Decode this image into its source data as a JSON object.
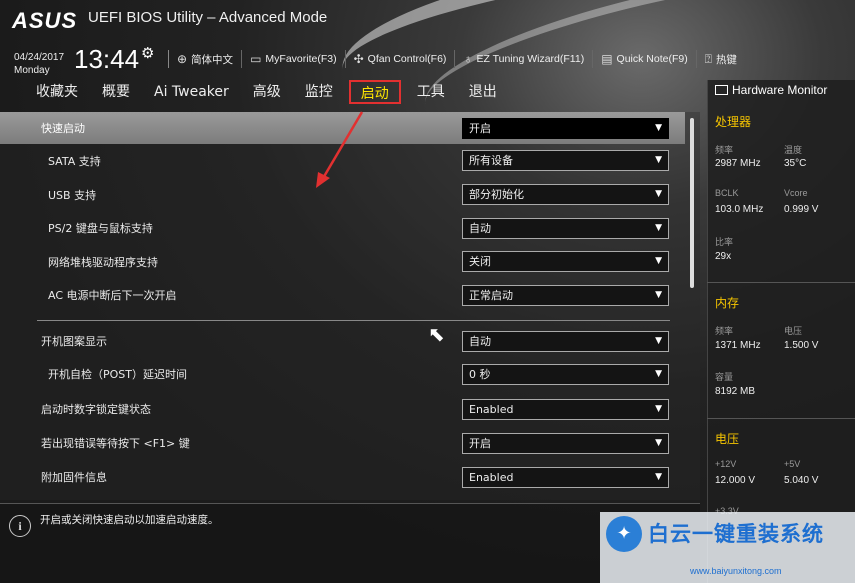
{
  "header": {
    "logo": "ASUS",
    "title": "UEFI BIOS Utility – Advanced Mode",
    "date": "04/24/2017",
    "weekday": "Monday",
    "time": "13:44",
    "toolbar": [
      {
        "icon": "globe-icon",
        "label": "简体中文"
      },
      {
        "icon": "favorite-icon",
        "label": "MyFavorite(F3)"
      },
      {
        "icon": "fan-icon",
        "label": "Qfan Control(F6)"
      },
      {
        "icon": "lightbulb-icon",
        "label": "EZ Tuning Wizard(F11)"
      },
      {
        "icon": "note-icon",
        "label": "Quick Note(F9)"
      },
      {
        "icon": "help-icon",
        "label": "热键"
      }
    ]
  },
  "nav": {
    "tabs": [
      "收藏夹",
      "概要",
      "Ai Tweaker",
      "高级",
      "监控",
      "启动",
      "工具",
      "退出"
    ],
    "active": "启动"
  },
  "settings": [
    {
      "label": "快速启动",
      "value": "开启"
    },
    {
      "label": "SATA 支持",
      "value": "所有设备"
    },
    {
      "label": "USB 支持",
      "value": "部分初始化"
    },
    {
      "label": "PS/2 键盘与鼠标支持",
      "value": "自动"
    },
    {
      "label": "网络堆栈驱动程序支持",
      "value": "关闭"
    },
    {
      "label": "AC 电源中断后下一次开启",
      "value": "正常启动"
    },
    {
      "label": "开机图案显示",
      "value": "自动"
    },
    {
      "label": "开机自检（POST）延迟时间",
      "value": "0 秒"
    },
    {
      "label": "启动时数字锁定键状态",
      "value": "Enabled"
    },
    {
      "label": "若出现错误等待按下 <F1> 键",
      "value": "开启"
    },
    {
      "label": "附加固件信息",
      "value": "Enabled"
    }
  ],
  "help_text": "开启或关闭快速启动以加速启动速度。",
  "hardware_monitor": {
    "title": "Hardware Monitor",
    "cpu": {
      "section": "处理器",
      "freq_label": "频率",
      "freq": "2987 MHz",
      "temp_label": "温度",
      "temp": "35°C",
      "bclk_label": "BCLK",
      "bclk": "103.0 MHz",
      "vcore_label": "Vcore",
      "vcore": "0.999 V",
      "ratio_label": "比率",
      "ratio": "29x"
    },
    "memory": {
      "section": "内存",
      "freq_label": "频率",
      "freq": "1371 MHz",
      "volt_label": "电压",
      "volt": "1.500 V",
      "cap_label": "容量",
      "cap": "8192 MB"
    },
    "voltage": {
      "section": "电压",
      "v12_label": "+12V",
      "v12": "12.000 V",
      "v5_label": "+5V",
      "v5": "5.040 V",
      "v33_label": "+3.3V"
    }
  },
  "watermark": {
    "text": "白云一键重装系统",
    "url": "www.baiyunxitong.com"
  },
  "colors": {
    "active_tab": "#ffe600",
    "tab_highlight_border": "#e23030",
    "monitor_section": "#f5c400",
    "watermark": "#1e6fd0"
  }
}
